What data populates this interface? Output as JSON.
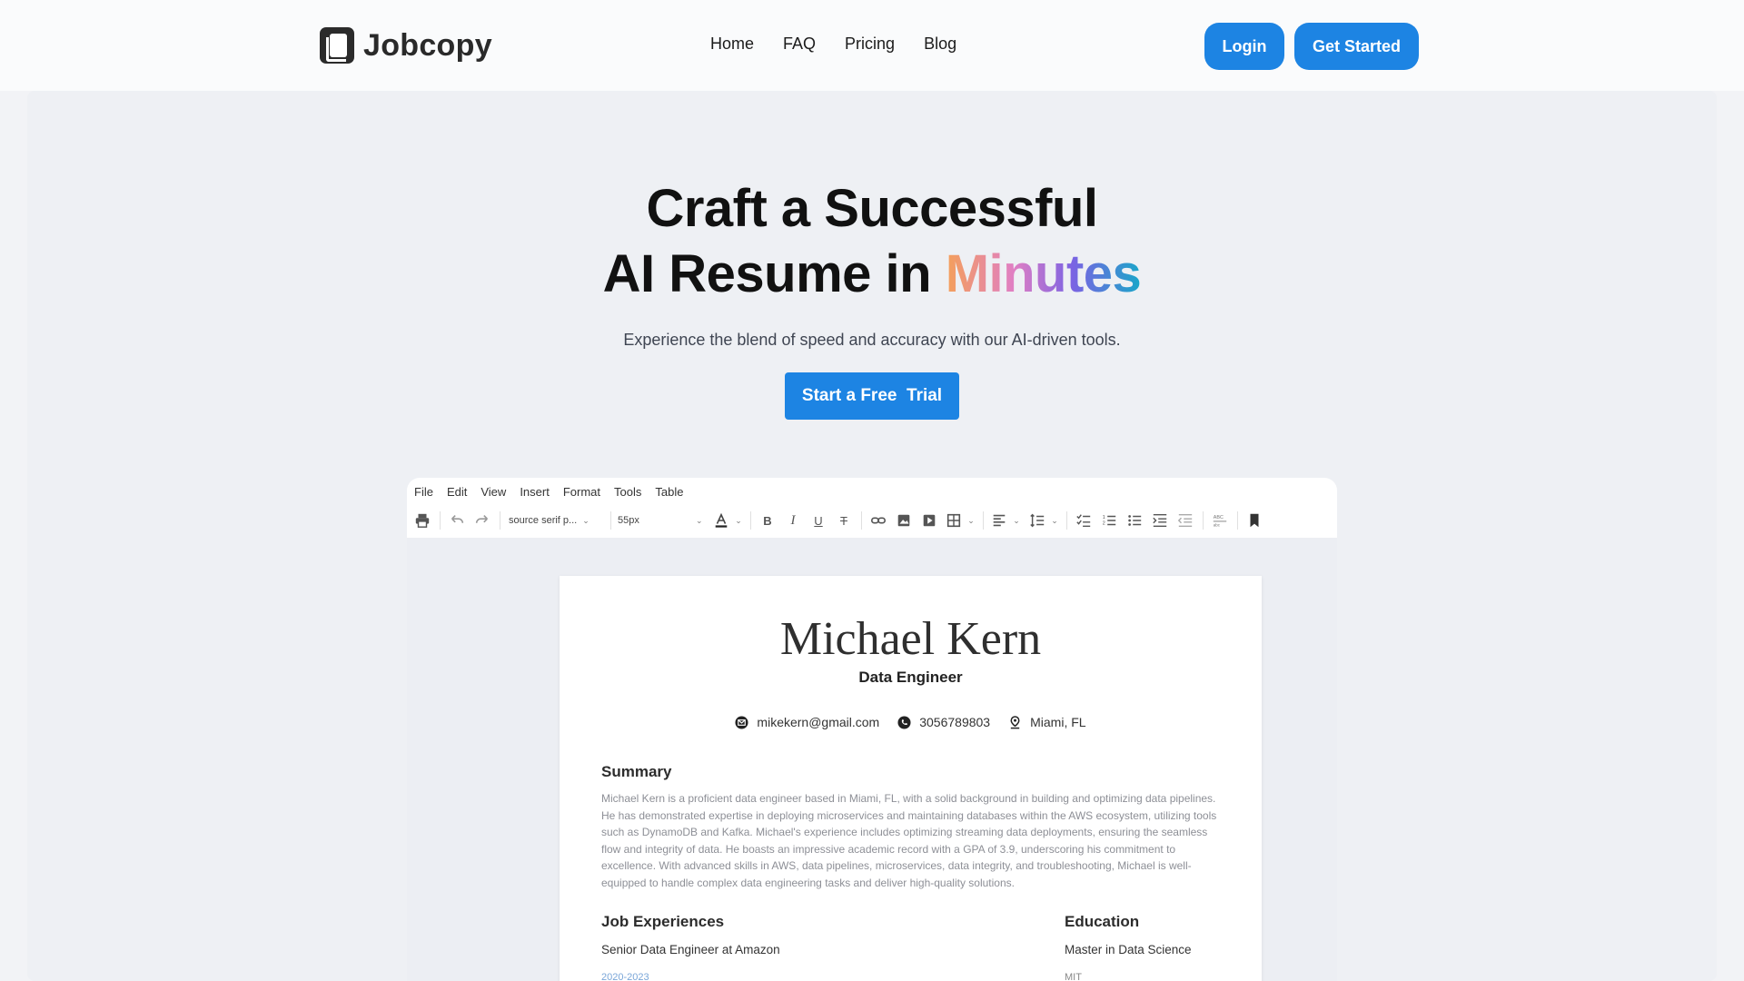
{
  "brand": {
    "name": "Jobcopy"
  },
  "nav": {
    "links": [
      "Home",
      "FAQ",
      "Pricing",
      "Blog"
    ],
    "login_label": "Login",
    "get_started_label": "Get Started"
  },
  "hero": {
    "title_line1": "Craft a Successful",
    "title_line2_prefix": "AI Resume in ",
    "title_line2_highlight": "Minutes",
    "subtitle": "Experience the blend of speed and accuracy with our AI-driven tools.",
    "cta_label": "Start a Free  Trial"
  },
  "editor": {
    "menu": [
      "File",
      "Edit",
      "View",
      "Insert",
      "Format",
      "Tools",
      "Table"
    ],
    "font_family": "source serif p...",
    "font_size": "55px"
  },
  "resume": {
    "name": "Michael Kern",
    "role": "Data Engineer",
    "email": "mikekern@gmail.com",
    "phone": "3056789803",
    "location": "Miami, FL",
    "summary_title": "Summary",
    "summary": "Michael Kern is a proficient data engineer based in Miami, FL, with a solid background in building and optimizing data pipelines. He has demonstrated expertise in deploying microservices and maintaining databases within the AWS ecosystem, utilizing tools such as DynamoDB and Kafka. Michael's experience includes optimizing streaming data deployments, ensuring the seamless flow and integrity of data. He boasts an impressive academic record with a GPA of 3.9, underscoring his commitment to excellence. With advanced skills in AWS, data pipelines, microservices, data integrity, and troubleshooting, Michael is well-equipped to handle complex data engineering tasks and deliver high-quality solutions.",
    "experience_title": "Job Experiences",
    "experience_role": "Senior Data Engineer at Amazon",
    "experience_dates": "2020-2023",
    "education_title": "Education",
    "education_degree": "Master in Data Science",
    "education_school": "MIT"
  },
  "colors": {
    "accent": "#1d84e3",
    "gradient": [
      "#f4a05a",
      "#e07fc4",
      "#7b63e3",
      "#1aa6c9"
    ]
  }
}
